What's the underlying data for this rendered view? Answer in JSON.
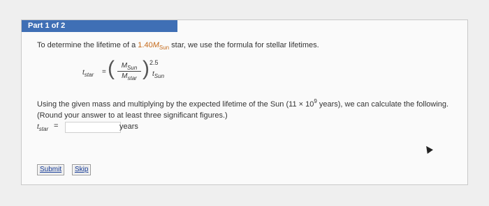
{
  "part_label": "Part 1 of 2",
  "intro": {
    "before": "To determine the lifetime of a ",
    "mass_value": "1.40",
    "mass_symbol": "M",
    "mass_sub": "Sun",
    "after": " star, we use the formula for stellar lifetimes."
  },
  "formula": {
    "lhs": "t",
    "lhs_sub": "star",
    "eq": "=",
    "num": "M",
    "num_sub": "Sun",
    "den": "M",
    "den_sub": "star",
    "exponent": "2.5",
    "rhs": "t",
    "rhs_sub": "Sun"
  },
  "question": {
    "part1": "Using the given mass and multiplying by the expected lifetime of the Sun (11 × 10",
    "exp": "9",
    "part2": " years), we can calculate the following. (Round your answer to at least three significant figures.)"
  },
  "answer": {
    "label": "t",
    "label_sub": "star",
    "eq": "=",
    "value": "",
    "unit": "years"
  },
  "buttons": {
    "submit": "Submit",
    "skip": "Skip"
  },
  "colors": {
    "header": "#3f6fb5",
    "accent": "#c56a1a"
  }
}
